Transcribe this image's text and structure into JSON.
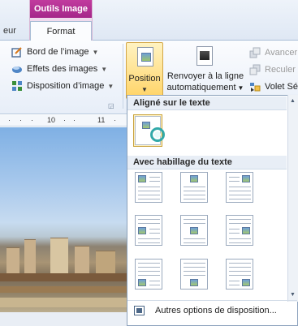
{
  "tabs": {
    "contextual_title": "Outils Image",
    "left_partial": "eur",
    "active_tab": "Format"
  },
  "ribbon": {
    "picture_styles": [
      {
        "label": "Bord de l’image",
        "icon": "picture-border-icon"
      },
      {
        "label": "Effets des images",
        "icon": "picture-effects-icon"
      },
      {
        "label": "Disposition d’image",
        "icon": "picture-layout-icon"
      }
    ],
    "position_label": "Position",
    "wrap_text_line1": "Renvoyer à la ligne",
    "wrap_text_line2": "automatiquement",
    "arrange": [
      {
        "label": "Avancer",
        "disabled": true
      },
      {
        "label": "Reculer",
        "disabled": true
      },
      {
        "label": "Volet Sé",
        "disabled": false
      }
    ]
  },
  "ruler": {
    "marks": [
      "10",
      "11"
    ]
  },
  "position_menu": {
    "inline_heading": "Aligné sur le texte",
    "wrap_heading": "Avec habillage du texte",
    "more_options": "Autres options de disposition..."
  }
}
